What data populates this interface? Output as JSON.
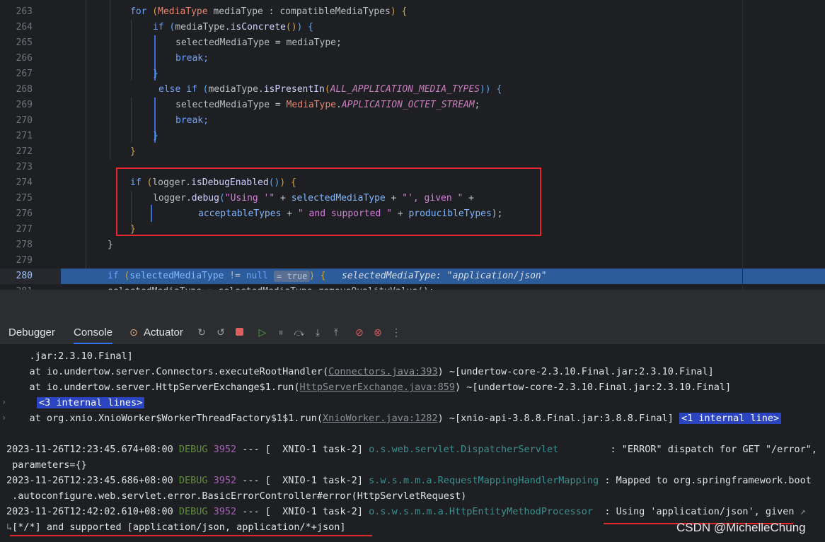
{
  "editor": {
    "line_numbers": [
      "263",
      "264",
      "265",
      "266",
      "267",
      "268",
      "269",
      "270",
      "271",
      "272",
      "273",
      "274",
      "275",
      "276",
      "277",
      "278",
      "279",
      "280",
      "281"
    ],
    "lines": {
      "l263": {
        "kw_for": "for",
        "paren_open": " (",
        "type": "MediaType",
        "var": " mediaType : compatibleMediaTypes",
        "close": ") {"
      },
      "l264": {
        "kw_if": "if",
        "open": " (",
        "obj": "mediaType.",
        "fn": "isConcrete",
        "call": "()",
        "close": ") {"
      },
      "l265": {
        "text": "selectedMediaType = mediaType;"
      },
      "l266": {
        "text": "break;"
      },
      "l267": {
        "text": "}"
      },
      "l268": {
        "kw_else": "else if",
        "open": " (",
        "obj": "mediaType.",
        "fn": "isPresentIn",
        "p": "(",
        "const": "ALL_APPLICATION_MEDIA_TYPES",
        "close": ")) {"
      },
      "l269": {
        "lhs": "selectedMediaType = ",
        "type": "MediaType",
        "dot": ".",
        "const": "APPLICATION_OCTET_STREAM",
        "semi": ";"
      },
      "l270": {
        "text": "break;"
      },
      "l271": {
        "text": "}"
      },
      "l272": {
        "text": "}"
      },
      "l274": {
        "kw_if": "if",
        "open": " (",
        "obj": "logger.",
        "fn": "isDebugEnabled",
        "call": "()",
        "close": ") {"
      },
      "l275": {
        "obj": "logger.",
        "fn": "debug",
        "p": "(",
        "s1": "\"Using '\"",
        "plus1": " + ",
        "var": "selectedMediaType",
        "plus2": " + ",
        "s2": "\"', given \"",
        "plus3": " +"
      },
      "l276": {
        "var1": "acceptableTypes",
        "plus1": " + ",
        "s1": "\" and supported \"",
        "plus2": " + ",
        "var2": "producibleTypes",
        "end": ");"
      },
      "l277": {
        "text": "}"
      },
      "l278": {
        "text": "}"
      },
      "l280": {
        "kw_if": "if",
        "open": " (",
        "var": "selectedMediaType",
        "op": " != ",
        "null": "null",
        "hint": "= true",
        "close": ") {",
        "inline": "selectedMediaType: \"application/json\""
      },
      "l281": {
        "text": "selectedMediaType = selectedMediaType.removeQualityValue();"
      }
    }
  },
  "toolbar": {
    "tabs": [
      "Debugger",
      "Console",
      "Actuator"
    ],
    "icons": [
      "actuator-icon",
      "rerun-icon",
      "restart-icon",
      "stop-icon",
      "resume-icon",
      "pause-icon",
      "step-over-icon",
      "step-into-icon",
      "step-out-icon",
      "breakpoints-icon",
      "mute-breakpoints-icon",
      "more-icon"
    ]
  },
  "console": {
    "l0": {
      "text": "    .jar:2.3.10.Final]"
    },
    "l1": {
      "pre": "    at io.undertow.server.Connectors.executeRootHandler(",
      "link": "Connectors.java:393",
      "post": ") ~[undertow-core-2.3.10.Final.jar:2.3.10.Final]"
    },
    "l2": {
      "pre": "    at io.undertow.server.HttpServerExchange$1.run(",
      "link": "HttpServerExchange.java:859",
      "post": ") ~[undertow-core-2.3.10.Final.jar:2.3.10.Final]"
    },
    "l3": {
      "il": "<3 internal lines>"
    },
    "l4": {
      "pre": "    at org.xnio.XnioWorker$WorkerThreadFactory$1$1.run(",
      "link": "XnioWorker.java:1282",
      "post": ") ~[xnio-api-3.8.8.Final.jar:3.8.8.Final]",
      "il": "<1 internal line>"
    },
    "logs": [
      {
        "ts": "2023-11-26T12:23:45.674+08:00",
        "lvl": "DEBUG",
        "pid": "3952",
        "sep": " --- [  XNIO-1 task-2] ",
        "cls": "o.s.web.servlet.DispatcherServlet        ",
        "msg": " : \"ERROR\" dispatch for GET \"/error\",",
        "cont": " parameters={}"
      },
      {
        "ts": "2023-11-26T12:23:45.686+08:00",
        "lvl": "DEBUG",
        "pid": "3952",
        "sep": " --- [  XNIO-1 task-2] ",
        "cls": "s.w.s.m.m.a.RequestMappingHandlerMapping",
        "msg": " : Mapped to org.springframework.boot",
        "cont": " .autoconfigure.web.servlet.error.BasicErrorController#error(HttpServletRequest)"
      },
      {
        "ts": "2023-11-26T12:42:02.610+08:00",
        "lvl": "DEBUG",
        "pid": "3952",
        "sep": " --- [  XNIO-1 task-2] ",
        "cls": "o.s.w.s.m.m.a.HttpEntityMethodProcessor ",
        "msg": " : Using 'application/json', given",
        "cont": "[*/*] and supported [application/json, application/*+json]"
      }
    ]
  },
  "watermark": "CSDN @MichelleChung"
}
